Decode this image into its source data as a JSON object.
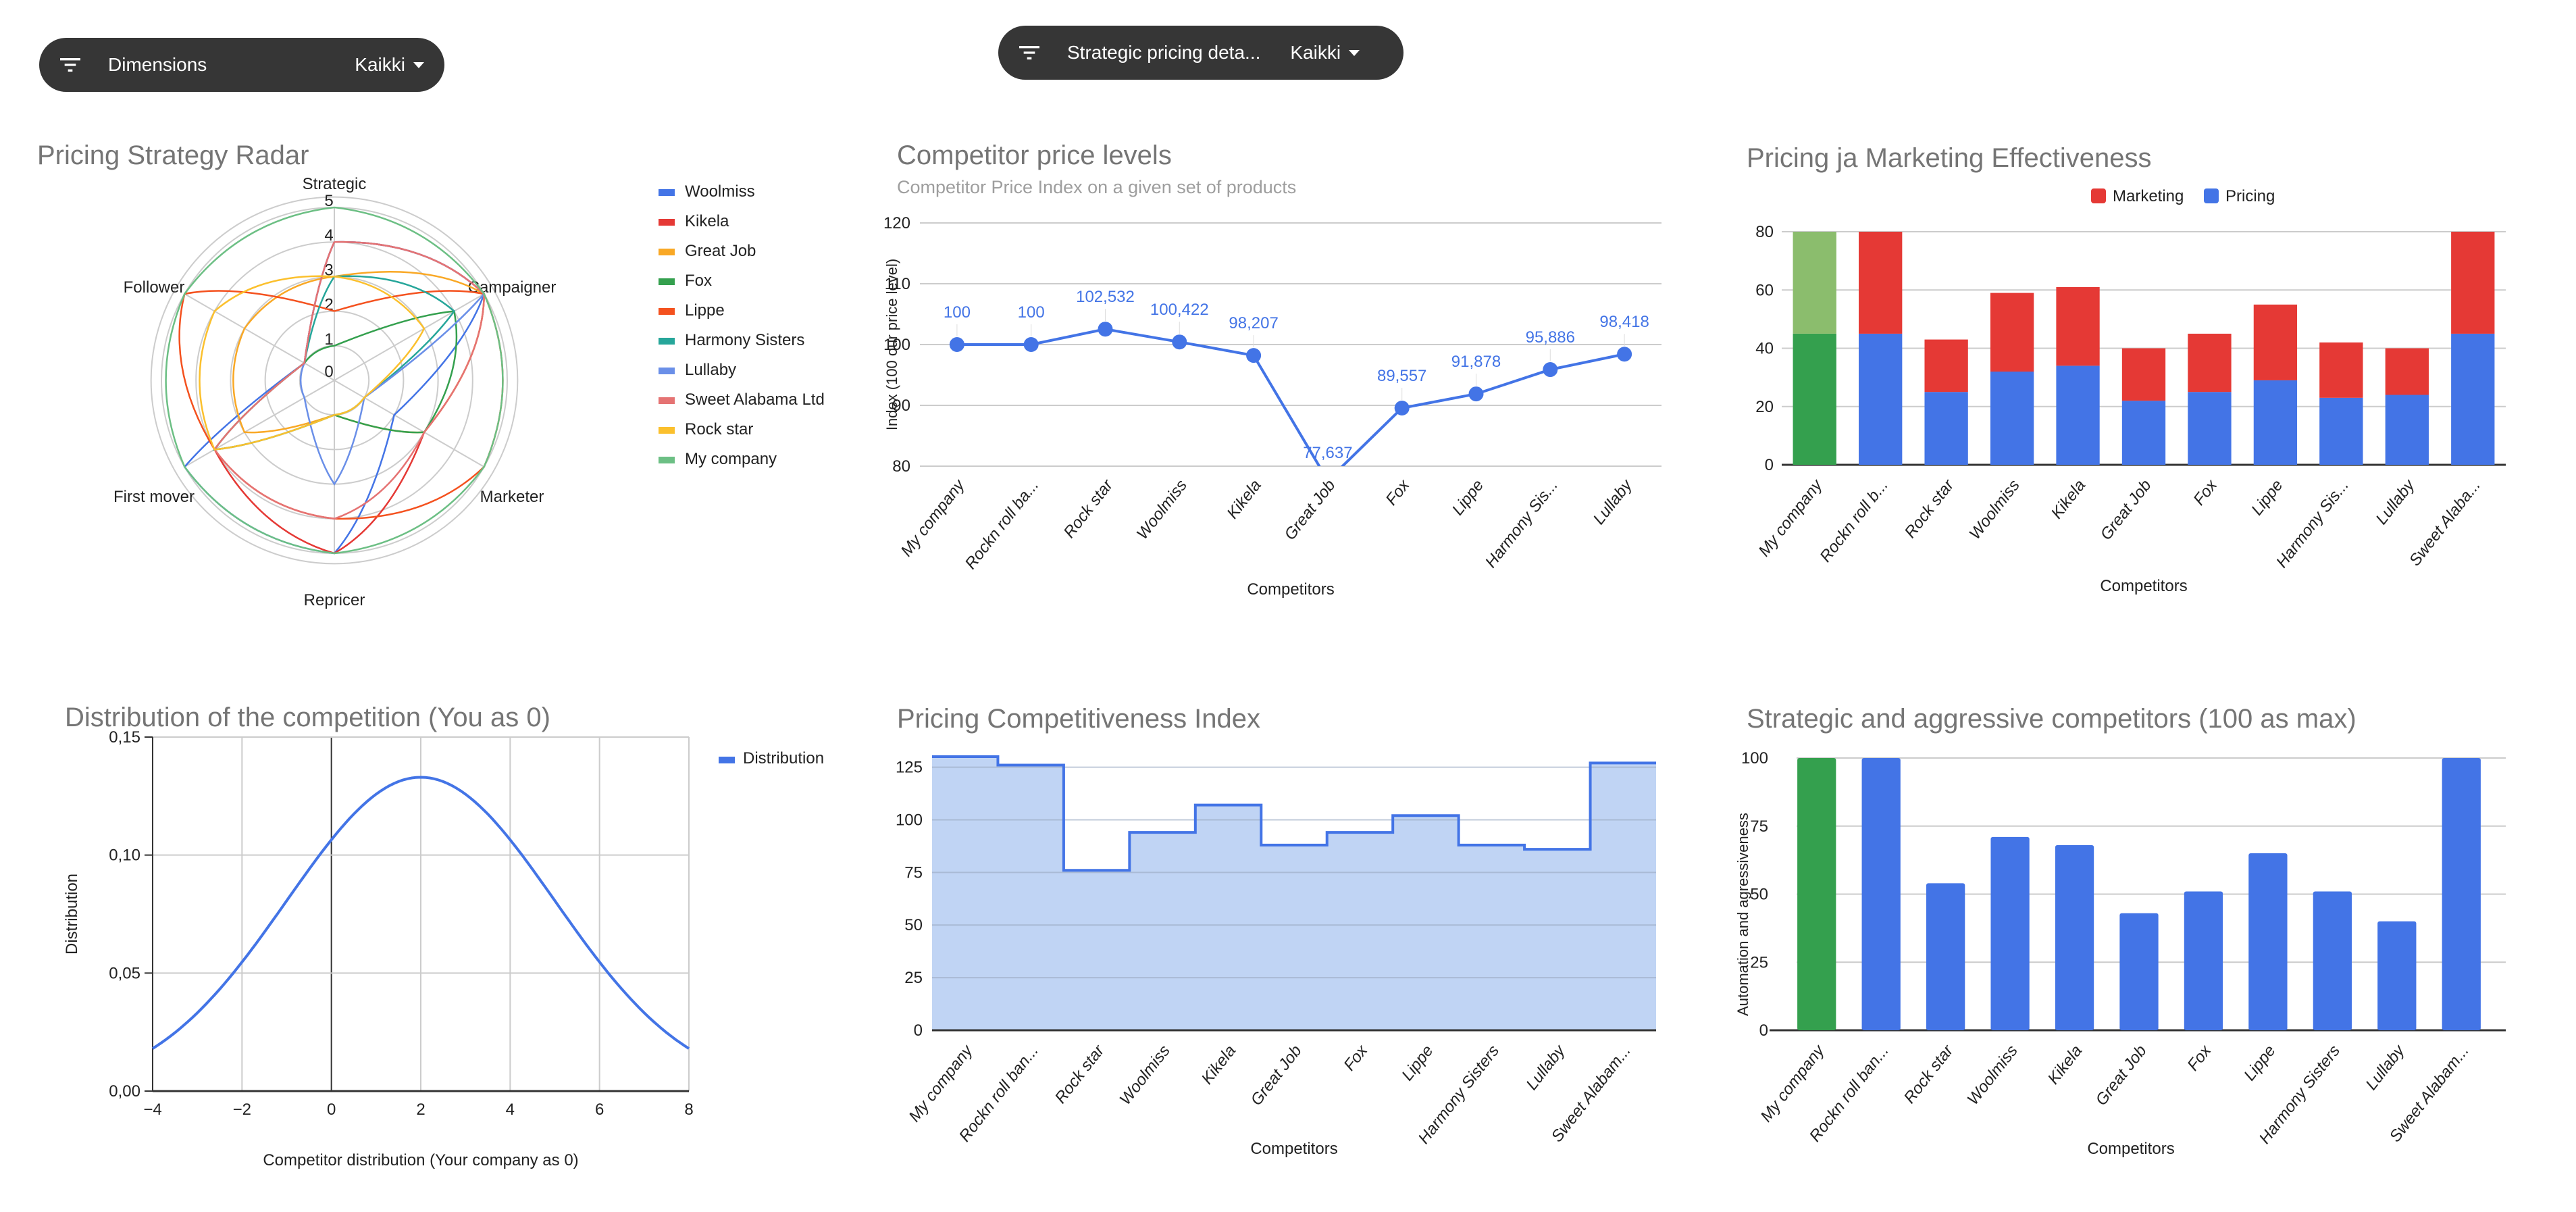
{
  "filters": [
    {
      "label": "Dimensions",
      "value": "Kaikki",
      "icon": "filter-icon"
    },
    {
      "label": "Strategic pricing deta...",
      "value": "Kaikki",
      "icon": "filter-icon"
    }
  ],
  "colors": {
    "blue": "#4374e6",
    "red": "#e53935",
    "green": "#34a04e",
    "light_green": "#8bbd6d",
    "area_fill": "#c0d4f4",
    "grid": "#cccccc",
    "title": "#757575"
  },
  "charts": {
    "radar": {
      "title": "Pricing Strategy Radar"
    },
    "price_levels": {
      "title": "Competitor price levels",
      "subtitle": "Competitor Price Index on a given set of products"
    },
    "effectiveness": {
      "title": "Pricing ja Marketing Effectiveness"
    },
    "distribution": {
      "title": "Distribution of the competition (You as 0)"
    },
    "competitiveness": {
      "title": "Pricing Competitiveness Index"
    },
    "aggressive": {
      "title": "Strategic and aggressive competitors (100 as max)"
    }
  },
  "chart_data": [
    {
      "id": "radar",
      "type": "radar",
      "title": "Pricing Strategy Radar",
      "axes": [
        "Strategic",
        "Campaigner",
        "Marketer",
        "Repricer",
        "First mover",
        "Follower"
      ],
      "ticks": [
        "0",
        "1",
        "2",
        "3",
        "4",
        "5"
      ],
      "range": [
        0,
        5
      ],
      "legend_position": "right",
      "series": [
        {
          "name": "Woolmiss",
          "color": "#4374e6",
          "values": [
            4,
            5,
            2,
            5,
            5,
            1
          ]
        },
        {
          "name": "Kikela",
          "color": "#e53935",
          "values": [
            4,
            5,
            3,
            5,
            4,
            1
          ]
        },
        {
          "name": "Great Job",
          "color": "#f9a825",
          "values": [
            3,
            5,
            3,
            1,
            3,
            3
          ]
        },
        {
          "name": "Fox",
          "color": "#34a04e",
          "values": [
            1,
            4,
            3,
            1,
            4,
            1
          ]
        },
        {
          "name": "Lippe",
          "color": "#f4511e",
          "values": [
            2,
            5,
            5,
            4,
            4,
            5
          ]
        },
        {
          "name": "Harmony Sisters",
          "color": "#26a69a",
          "values": [
            3,
            4,
            1,
            1,
            4,
            1
          ]
        },
        {
          "name": "Lullaby",
          "color": "#6a8fe8",
          "values": [
            4,
            5,
            1,
            3,
            1,
            1
          ]
        },
        {
          "name": "Sweet Alabama Ltd",
          "color": "#e57373",
          "values": [
            4,
            5,
            3,
            4,
            4,
            1
          ]
        },
        {
          "name": "Rock star",
          "color": "#fbc02d",
          "values": [
            3,
            3,
            1,
            1,
            4,
            4
          ]
        },
        {
          "name": "My company",
          "color": "#6cbf84",
          "values": [
            5,
            5,
            5,
            5,
            5,
            5
          ]
        }
      ]
    },
    {
      "id": "price_levels",
      "type": "line",
      "title": "Competitor price levels",
      "subtitle": "Competitor Price Index on a given set of products",
      "xlabel": "Competitors",
      "ylabel": "Index (100 our price level)",
      "categories": [
        "My company",
        "Rockn roll ba...",
        "Rock star",
        "Woolmiss",
        "Kikela",
        "Great Job",
        "Fox",
        "Lippe",
        "Harmony Sis...",
        "Lullaby"
      ],
      "values": [
        100,
        100,
        102.532,
        100.422,
        98.207,
        77.637,
        89.557,
        91.878,
        95.886,
        98.418
      ],
      "data_labels": [
        "100",
        "100",
        "102,532",
        "100,422",
        "98,207",
        "77,637",
        "89,557",
        "91,878",
        "95,886",
        "98,418"
      ],
      "yticks": [
        "80",
        "90",
        "100",
        "110",
        "120"
      ],
      "ylim": [
        80,
        120
      ],
      "grid": true
    },
    {
      "id": "effectiveness",
      "type": "bar",
      "stacked": true,
      "title": "Pricing ja Marketing Effectiveness",
      "xlabel": "Competitors",
      "categories": [
        "My company",
        "Rockn roll b...",
        "Rock star",
        "Woolmiss",
        "Kikela",
        "Great Job",
        "Fox",
        "Lippe",
        "Harmony Sis...",
        "Lullaby",
        "Sweet Alaba..."
      ],
      "series": [
        {
          "name": "Pricing",
          "color": "#4374e6",
          "values": [
            45,
            45,
            25,
            32,
            34,
            22,
            25,
            29,
            23,
            24,
            45
          ]
        },
        {
          "name": "Marketing",
          "color": "#e53935",
          "values": [
            35,
            35,
            18,
            27,
            27,
            18,
            20,
            26,
            19,
            16,
            35
          ]
        }
      ],
      "highlight": {
        "category": "My company",
        "pricing_color": "#34a04e",
        "marketing_color": "#8bbd6d"
      },
      "legend": [
        "Marketing",
        "Pricing"
      ],
      "legend_position": "top",
      "yticks": [
        "0",
        "20",
        "40",
        "60",
        "80"
      ],
      "ylim": [
        0,
        80
      ],
      "grid": true
    },
    {
      "id": "distribution",
      "type": "line",
      "title": "Distribution of the competition (You as 0)",
      "xlabel": "Competitor distribution (Your company as 0)",
      "ylabel": "Distribution",
      "series": [
        {
          "name": "Distribution",
          "color": "#4374e6",
          "mean": 2,
          "sd": 3,
          "x": [
            -4,
            -3,
            -2,
            -1,
            0,
            1,
            2,
            3,
            4,
            5,
            6,
            7,
            8
          ],
          "y": [
            0.018,
            0.033,
            0.055,
            0.081,
            0.106,
            0.126,
            0.133,
            0.126,
            0.106,
            0.081,
            0.055,
            0.033,
            0.018
          ]
        }
      ],
      "xticks": [
        "−4",
        "−2",
        "0",
        "2",
        "4",
        "6",
        "8"
      ],
      "yticks": [
        "0,00",
        "0,05",
        "0,10",
        "0,15"
      ],
      "xlim": [
        -4,
        8
      ],
      "ylim": [
        0,
        0.15
      ],
      "legend_position": "top-right",
      "grid": true
    },
    {
      "id": "competitiveness",
      "type": "area",
      "stepped": true,
      "title": "Pricing Competitiveness Index",
      "xlabel": "Competitors",
      "categories": [
        "My company",
        "Rockn roll ban...",
        "Rock star",
        "Woolmiss",
        "Kikela",
        "Great Job",
        "Fox",
        "Lippe",
        "Harmony Sisters",
        "Lullaby",
        "Sweet Alabam..."
      ],
      "values": [
        130,
        126,
        76,
        94,
        107,
        88,
        94,
        102,
        88,
        86,
        127
      ],
      "yticks": [
        "0",
        "25",
        "50",
        "75",
        "100",
        "125"
      ],
      "ylim": [
        0,
        130
      ],
      "grid": true
    },
    {
      "id": "aggressive",
      "type": "bar",
      "title": "Strategic and aggressive competitors (100 as max)",
      "xlabel": "Competitors",
      "ylabel": "Automation and agressiveness",
      "categories": [
        "My company",
        "Rockn roll ban...",
        "Rock star",
        "Woolmiss",
        "Kikela",
        "Great Job",
        "Fox",
        "Lippe",
        "Harmony Sisters",
        "Lullaby",
        "Sweet Alabam..."
      ],
      "values": [
        100,
        100,
        54,
        71,
        68,
        43,
        51,
        65,
        51,
        40,
        100
      ],
      "bar_colors": [
        "#34a04e",
        "#4374e6",
        "#4374e6",
        "#4374e6",
        "#4374e6",
        "#4374e6",
        "#4374e6",
        "#4374e6",
        "#4374e6",
        "#4374e6",
        "#4374e6"
      ],
      "yticks": [
        "0",
        "25",
        "50",
        "75",
        "100"
      ],
      "ylim": [
        0,
        100
      ],
      "grid": true
    }
  ]
}
